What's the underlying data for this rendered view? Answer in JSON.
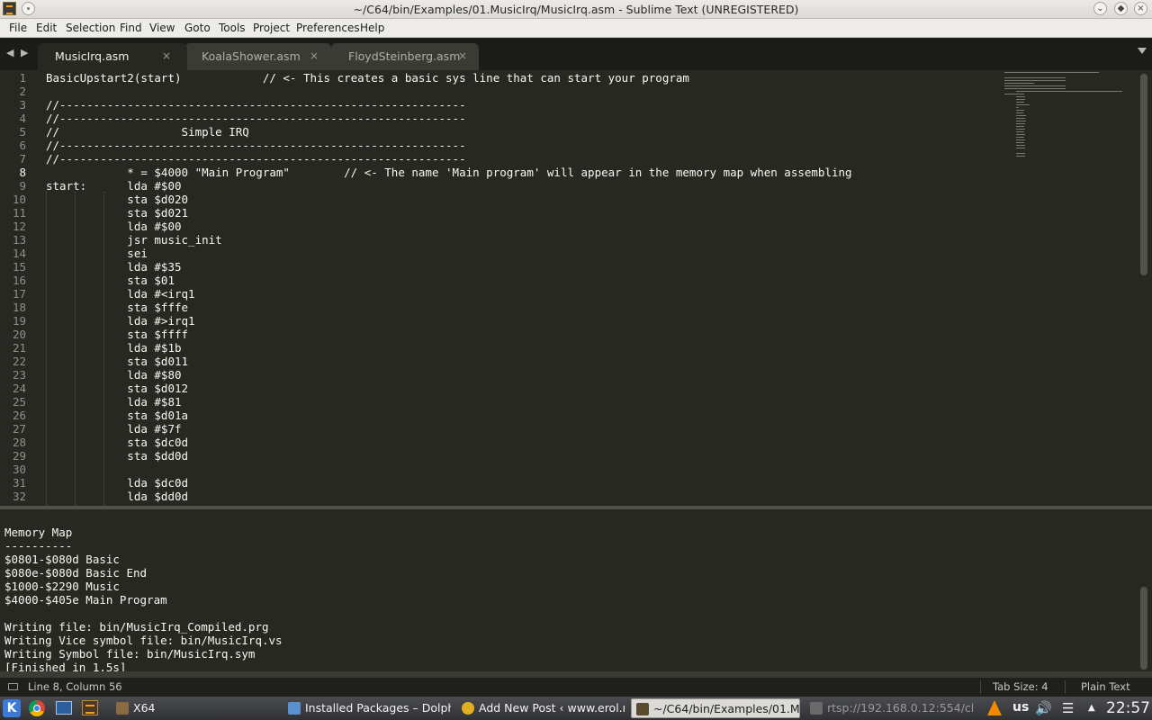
{
  "window": {
    "title": "~/C64/bin/Examples/01.MusicIrq/MusicIrq.asm - Sublime Text (UNREGISTERED)"
  },
  "menu": [
    "File",
    "Edit",
    "Selection",
    "Find",
    "View",
    "Goto",
    "Tools",
    "Project",
    "Preferences",
    "Help"
  ],
  "tabs": [
    {
      "label": "MusicIrq.asm",
      "active": true
    },
    {
      "label": "KoalaShower.asm",
      "active": false
    },
    {
      "label": "FloydSteinberg.asm",
      "active": false
    }
  ],
  "editor": {
    "current_line": 8,
    "lines": [
      {
        "n": "1",
        "text": "BasicUpstart2(start)            // <- This creates a basic sys line that can start your program"
      },
      {
        "n": "2",
        "text": ""
      },
      {
        "n": "3",
        "text": "//------------------------------------------------------------"
      },
      {
        "n": "4",
        "text": "//------------------------------------------------------------"
      },
      {
        "n": "5",
        "text": "//                  Simple IRQ"
      },
      {
        "n": "6",
        "text": "//------------------------------------------------------------"
      },
      {
        "n": "7",
        "text": "//------------------------------------------------------------"
      },
      {
        "n": "8",
        "text": "            * = $4000 \"Main Program\"        // <- The name 'Main program' will appear in the memory map when assembling"
      },
      {
        "n": "9",
        "text": "start:      lda #$00"
      },
      {
        "n": "10",
        "text": "            sta $d020"
      },
      {
        "n": "11",
        "text": "            sta $d021"
      },
      {
        "n": "12",
        "text": "            lda #$00"
      },
      {
        "n": "13",
        "text": "            jsr music_init"
      },
      {
        "n": "14",
        "text": "            sei"
      },
      {
        "n": "15",
        "text": "            lda #$35"
      },
      {
        "n": "16",
        "text": "            sta $01"
      },
      {
        "n": "17",
        "text": "            lda #<irq1"
      },
      {
        "n": "18",
        "text": "            sta $fffe"
      },
      {
        "n": "19",
        "text": "            lda #>irq1"
      },
      {
        "n": "20",
        "text": "            sta $ffff"
      },
      {
        "n": "21",
        "text": "            lda #$1b"
      },
      {
        "n": "22",
        "text": "            sta $d011"
      },
      {
        "n": "23",
        "text": "            lda #$80"
      },
      {
        "n": "24",
        "text": "            sta $d012"
      },
      {
        "n": "25",
        "text": "            lda #$81"
      },
      {
        "n": "26",
        "text": "            sta $d01a"
      },
      {
        "n": "27",
        "text": "            lda #$7f"
      },
      {
        "n": "28",
        "text": "            sta $dc0d"
      },
      {
        "n": "29",
        "text": "            sta $dd0d"
      },
      {
        "n": "30",
        "text": ""
      },
      {
        "n": "31",
        "text": "            lda $dc0d"
      },
      {
        "n": "32",
        "text": "            lda $dd0d"
      }
    ]
  },
  "output": {
    "lines": [
      "Memory Map",
      "----------",
      "$0801-$080d Basic",
      "$080e-$080d Basic End",
      "$1000-$2290 Music",
      "$4000-$405e Main Program",
      "",
      "Writing file: bin/MusicIrq_Compiled.prg",
      "Writing Vice symbol file: bin/MusicIrq.vs",
      "Writing Symbol file: bin/MusicIrq.sym",
      "[Finished in 1.5s]"
    ]
  },
  "status": {
    "position": "Line 8, Column 56",
    "tab_size": "Tab Size: 4",
    "syntax": "Plain Text"
  },
  "taskbar": {
    "tasks": [
      {
        "label": "X64",
        "icon": "x64-icon",
        "color": "#8a6a40",
        "active": false
      },
      {
        "label": "Installed Packages – Dolph",
        "icon": "dolphin-icon",
        "color": "#5a8fd0",
        "active": false
      },
      {
        "label": "Add New Post ‹ www.erol.n",
        "icon": "chrome-icon",
        "color": "#e0b020",
        "active": false
      },
      {
        "label": "~/C64/bin/Examples/01.M",
        "icon": "sublime-icon",
        "color": "#5a4a30",
        "active": true
      },
      {
        "label": "rtsp://192.168.0.12:554/cl",
        "icon": "vlc-icon",
        "color": "#6a6a6a",
        "active": false
      }
    ],
    "keyboard_layout": "us",
    "clock": "22:57"
  },
  "colors": {
    "editor_bg": "#272822",
    "tab_bar_bg": "#1b1c17",
    "status_bar_bg": "#1f201b",
    "accent_orange": "#f0a020"
  }
}
